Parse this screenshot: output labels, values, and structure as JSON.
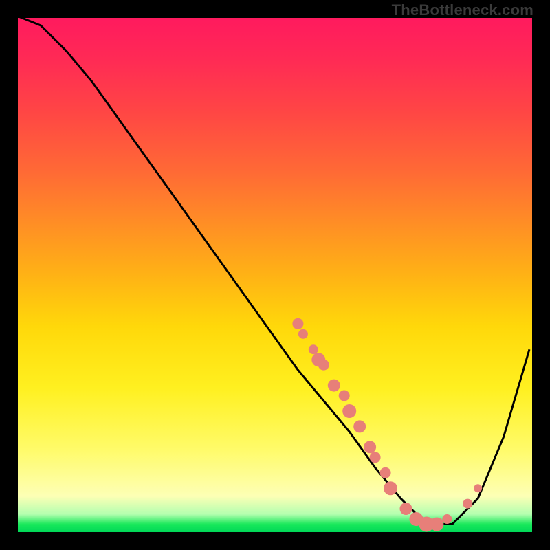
{
  "watermark": "TheBottleneck.com",
  "chart_data": {
    "type": "line",
    "title": "",
    "xlabel": "",
    "ylabel": "",
    "xlim": [
      0,
      100
    ],
    "ylim": [
      0,
      100
    ],
    "grid": false,
    "legend": false,
    "series": [
      {
        "name": "curve",
        "x": [
          0,
          5,
          10,
          15,
          20,
          25,
          30,
          35,
          40,
          45,
          50,
          55,
          60,
          65,
          70,
          75,
          78,
          81,
          85,
          90,
          95,
          100
        ],
        "y": [
          100,
          98,
          93,
          87,
          80,
          73,
          66,
          59,
          52,
          45,
          38,
          31,
          25,
          19,
          12,
          6,
          3,
          1,
          1,
          6,
          18,
          35
        ]
      }
    ],
    "markers": [
      {
        "x": 55,
        "y": 40,
        "r": 8
      },
      {
        "x": 56,
        "y": 38,
        "r": 7
      },
      {
        "x": 58,
        "y": 35,
        "r": 7
      },
      {
        "x": 59,
        "y": 33,
        "r": 10
      },
      {
        "x": 60,
        "y": 32,
        "r": 8
      },
      {
        "x": 62,
        "y": 28,
        "r": 9
      },
      {
        "x": 64,
        "y": 26,
        "r": 8
      },
      {
        "x": 65,
        "y": 23,
        "r": 10
      },
      {
        "x": 67,
        "y": 20,
        "r": 9
      },
      {
        "x": 69,
        "y": 16,
        "r": 9
      },
      {
        "x": 70,
        "y": 14,
        "r": 8
      },
      {
        "x": 72,
        "y": 11,
        "r": 8
      },
      {
        "x": 73,
        "y": 8,
        "r": 10
      },
      {
        "x": 76,
        "y": 4,
        "r": 9
      },
      {
        "x": 78,
        "y": 2,
        "r": 10
      },
      {
        "x": 80,
        "y": 1,
        "r": 11
      },
      {
        "x": 82,
        "y": 1,
        "r": 10
      },
      {
        "x": 84,
        "y": 2,
        "r": 7
      },
      {
        "x": 88,
        "y": 5,
        "r": 7
      },
      {
        "x": 90,
        "y": 8,
        "r": 6
      }
    ],
    "gradient_stops": [
      {
        "pos": 0,
        "color": "#ff1a5e"
      },
      {
        "pos": 0.3,
        "color": "#ff6a35"
      },
      {
        "pos": 0.6,
        "color": "#ffd80a"
      },
      {
        "pos": 0.93,
        "color": "#fdffb5"
      },
      {
        "pos": 1.0,
        "color": "#00d858"
      }
    ]
  }
}
